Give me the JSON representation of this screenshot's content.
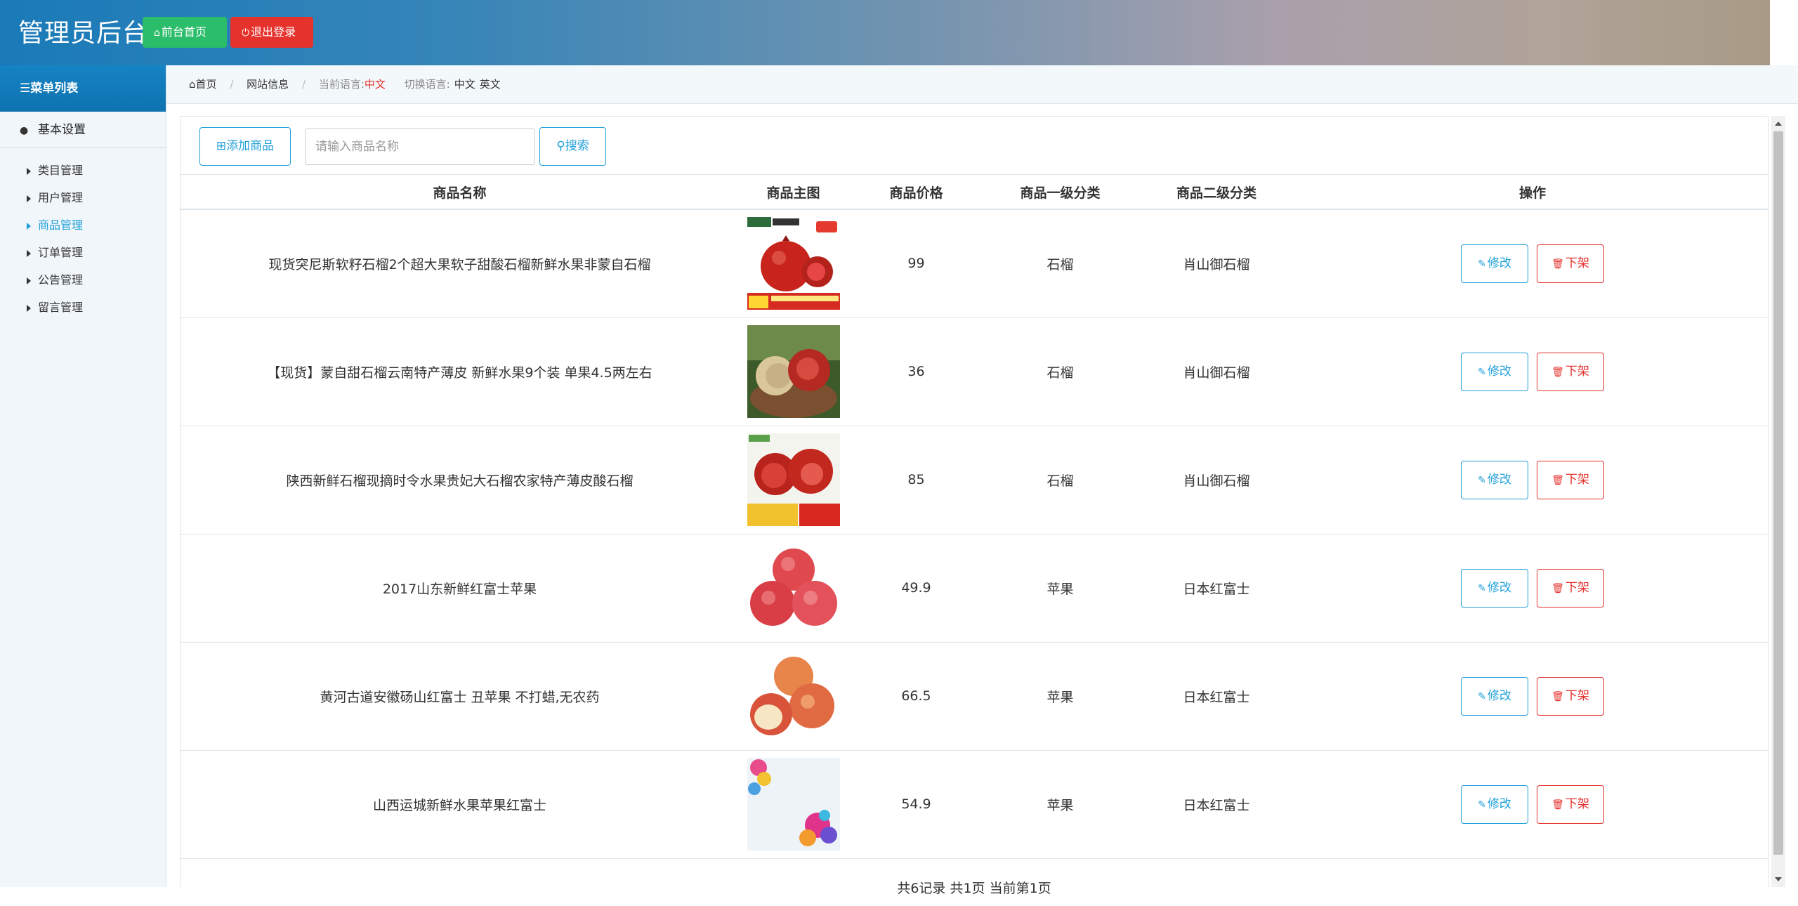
{
  "header": {
    "title": "管理员后台",
    "home_button": "前台首页",
    "logout_button": "退出登录"
  },
  "sidebar": {
    "menu_title": "菜单列表",
    "group_label": "基本设置",
    "items": [
      {
        "label": "类目管理",
        "active": false
      },
      {
        "label": "用户管理",
        "active": false
      },
      {
        "label": "商品管理",
        "active": true
      },
      {
        "label": "订单管理",
        "active": false
      },
      {
        "label": "公告管理",
        "active": false
      },
      {
        "label": "留言管理",
        "active": false
      }
    ]
  },
  "breadcrumb": {
    "home": "首页",
    "site_info": "网站信息",
    "current_lang_label": "当前语言:",
    "current_lang": "中文",
    "switch_lang_label": "切换语言:",
    "lang_zh": "中文",
    "lang_en": "英文"
  },
  "toolbar": {
    "add_button": "添加商品",
    "search_placeholder": "请输入商品名称",
    "search_button": "搜索"
  },
  "table": {
    "columns": [
      "商品名称",
      "商品主图",
      "商品价格",
      "商品一级分类",
      "商品二级分类",
      "操作"
    ],
    "edit_label": "修改",
    "remove_label": "下架",
    "rows": [
      {
        "name": "现货突尼斯软籽石榴2个超大果软子甜酸石榴新鲜水果非蒙自石榴",
        "image": "pomegranate-promo",
        "price": "99",
        "cat1": "石榴",
        "cat2": "肖山御石榴"
      },
      {
        "name": "【现货】蒙自甜石榴云南特产薄皮 新鲜水果9个装 单果4.5两左右",
        "image": "pomegranate-basket",
        "price": "36",
        "cat1": "石榴",
        "cat2": "肖山御石榴"
      },
      {
        "name": "陕西新鲜石榴现摘时令水果贵妃大石榴农家特产薄皮酸石榴",
        "image": "pomegranate-sour",
        "price": "85",
        "cat1": "石榴",
        "cat2": "肖山御石榴"
      },
      {
        "name": "2017山东新鲜红富士苹果",
        "image": "apples-red",
        "price": "49.9",
        "cat1": "苹果",
        "cat2": "日本红富士"
      },
      {
        "name": "黄河古道安徽砀山红富士 丑苹果 不打蜡,无农药",
        "image": "apples-cut",
        "price": "66.5",
        "cat1": "苹果",
        "cat2": "日本红富士"
      },
      {
        "name": "山西运城新鲜水果苹果红富士",
        "image": "balloons",
        "price": "54.9",
        "cat1": "苹果",
        "cat2": "日本红富士"
      }
    ]
  },
  "pager": {
    "text": "共6记录  共1页  当前第1页"
  },
  "colors": {
    "accent": "#1e9fd8",
    "danger": "#e5322d",
    "success": "#2bbd6a"
  }
}
